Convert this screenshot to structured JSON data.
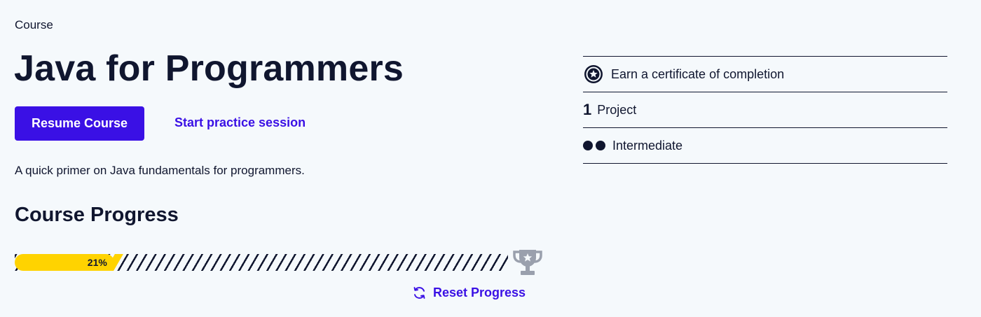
{
  "header": {
    "eyebrow": "Course",
    "title": "Java for Programmers"
  },
  "actions": {
    "resume_label": "Resume Course",
    "practice_label": "Start practice session"
  },
  "description": "A quick primer on Java fundamentals for programmers.",
  "progress": {
    "heading": "Course Progress",
    "percent_label": "21%",
    "value": 0.21,
    "reset_label": "Reset Progress",
    "trophy_icon": "trophy-icon",
    "reset_icon": "refresh-icon"
  },
  "details": {
    "certificate_label": "Earn a certificate of completion",
    "certificate_icon": "certificate-star-icon",
    "project_count": "1",
    "project_label": "Project",
    "level_label": "Intermediate",
    "level_icon": "level-dots-icon"
  },
  "colors": {
    "accent": "#3a10e5",
    "text": "#10162f",
    "progress_fill": "#ffd300",
    "background": "#f5f9fc",
    "trophy": "#9aa0ad"
  }
}
